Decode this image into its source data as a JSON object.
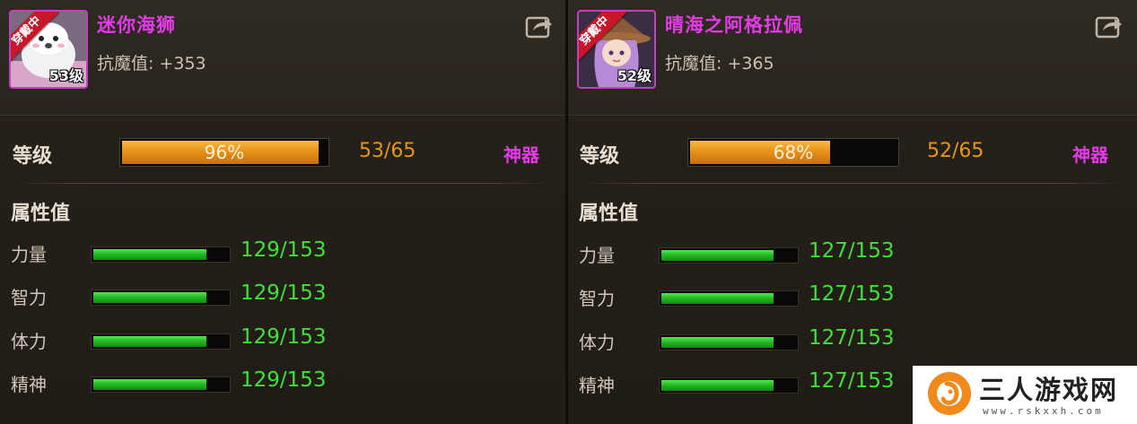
{
  "ui": {
    "level_label": "等级",
    "artifact_label": "神器",
    "attributes_title": "属性值",
    "equipped_badge": "穿戴中"
  },
  "heroes": [
    {
      "name": "迷你海狮",
      "magic_resist_label": "抗魔值:",
      "magic_resist_value": "+353",
      "avatar_level": "53级",
      "exp_percent": 0.96,
      "exp_percent_text": "96%",
      "level_progress": "53/65",
      "stats": [
        {
          "label": "力量",
          "value": "129/153",
          "fraction": 0.843
        },
        {
          "label": "智力",
          "value": "129/153",
          "fraction": 0.843
        },
        {
          "label": "体力",
          "value": "129/153",
          "fraction": 0.843
        },
        {
          "label": "精神",
          "value": "129/153",
          "fraction": 0.843
        }
      ]
    },
    {
      "name": "晴海之阿格拉佩",
      "magic_resist_label": "抗魔值:",
      "magic_resist_value": "+365",
      "avatar_level": "52级",
      "exp_percent": 0.68,
      "exp_percent_text": "68%",
      "level_progress": "52/65",
      "stats": [
        {
          "label": "力量",
          "value": "127/153",
          "fraction": 0.83
        },
        {
          "label": "智力",
          "value": "127/153",
          "fraction": 0.83
        },
        {
          "label": "体力",
          "value": "127/153",
          "fraction": 0.83
        },
        {
          "label": "精神",
          "value": "127/153",
          "fraction": 0.83
        }
      ]
    }
  ],
  "watermark": {
    "title": "三人游戏网",
    "url": "www.rskxxh.com"
  },
  "colors": {
    "name": "#e43be8",
    "exp_fill": "#e8931a",
    "stat_fill": "#22b622",
    "stat_text": "#3fe03a",
    "level_count": "#e0961f"
  }
}
